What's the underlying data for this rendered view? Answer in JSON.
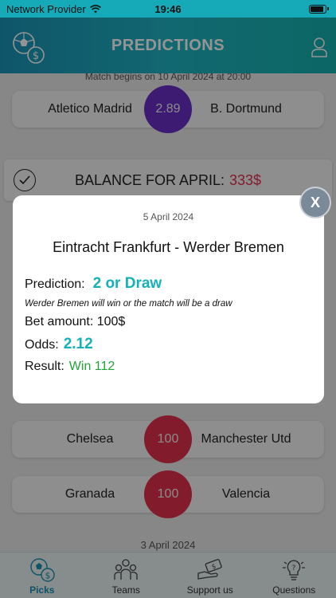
{
  "status_bar": {
    "carrier": "Network Provider",
    "time": "19:46"
  },
  "header": {
    "title": "PREDICTIONS"
  },
  "list": {
    "top_note": "Match begins on 10 April 2024 at 20:00",
    "match1": {
      "home": "Atletico Madrid",
      "odds": "2.89",
      "away": "B. Dortmund"
    },
    "balance": {
      "label": "BALANCE FOR APRIL:",
      "amount": "333$"
    },
    "match2": {
      "home": "Chelsea",
      "odds": "100",
      "away": "Manchester Utd"
    },
    "match3": {
      "home": "Granada",
      "odds": "100",
      "away": "Valencia"
    },
    "date_bottom": "3 April 2024"
  },
  "modal": {
    "date": "5 April 2024",
    "title": "Eintracht Frankfurt - Werder Bremen",
    "prediction_label": "Prediction:",
    "prediction_value": "2 or Draw",
    "explanation": "Werder Bremen will win or the match will be a draw",
    "bet_amount": "Bet amount: 100$",
    "odds_label": "Odds:",
    "odds_value": "2.12",
    "result_label": "Result:",
    "result_value": "Win 112",
    "close_label": "X"
  },
  "tabs": [
    {
      "label": "Picks",
      "icon": "soccer-coin-icon",
      "active": true
    },
    {
      "label": "Teams",
      "icon": "team-icon",
      "active": false
    },
    {
      "label": "Support us",
      "icon": "money-hand-icon",
      "active": false
    },
    {
      "label": "Questions",
      "icon": "lightbulb-question-icon",
      "active": false
    }
  ],
  "colors": {
    "accent": "#16b1b5",
    "odds_purple": "#6a2fc7",
    "odds_red": "#e0304a",
    "win_green": "#22a23a"
  }
}
